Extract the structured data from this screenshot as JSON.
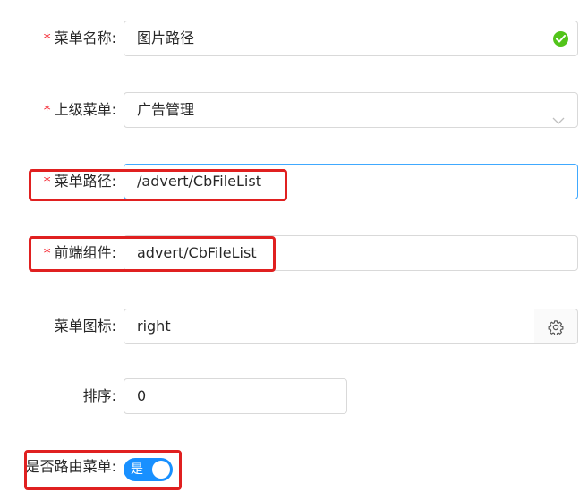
{
  "form": {
    "menu_name": {
      "required_mark": "*",
      "label": "菜单名称:",
      "value": "图片路径",
      "status_icon": "check-circle-icon",
      "status_color": "#52c41a"
    },
    "parent_menu": {
      "required_mark": "*",
      "label": "上级菜单:",
      "value": "广告管理",
      "icon": "chevron-down-icon"
    },
    "menu_path": {
      "required_mark": "*",
      "label": "菜单路径:",
      "value": "/advert/CbFileList"
    },
    "component": {
      "required_mark": "*",
      "label": "前端组件:",
      "value": "advert/CbFileList"
    },
    "menu_icon": {
      "label": "菜单图标:",
      "value": "right",
      "addon_icon": "gear-icon"
    },
    "sort": {
      "label": "排序:",
      "value": "0"
    },
    "is_route": {
      "label": "是否路由菜单:",
      "switch_text": "是",
      "checked": true
    }
  },
  "colors": {
    "required": "#f5222d",
    "primary": "#1890ff",
    "highlight": "#e02020",
    "border": "#d9d9d9"
  }
}
